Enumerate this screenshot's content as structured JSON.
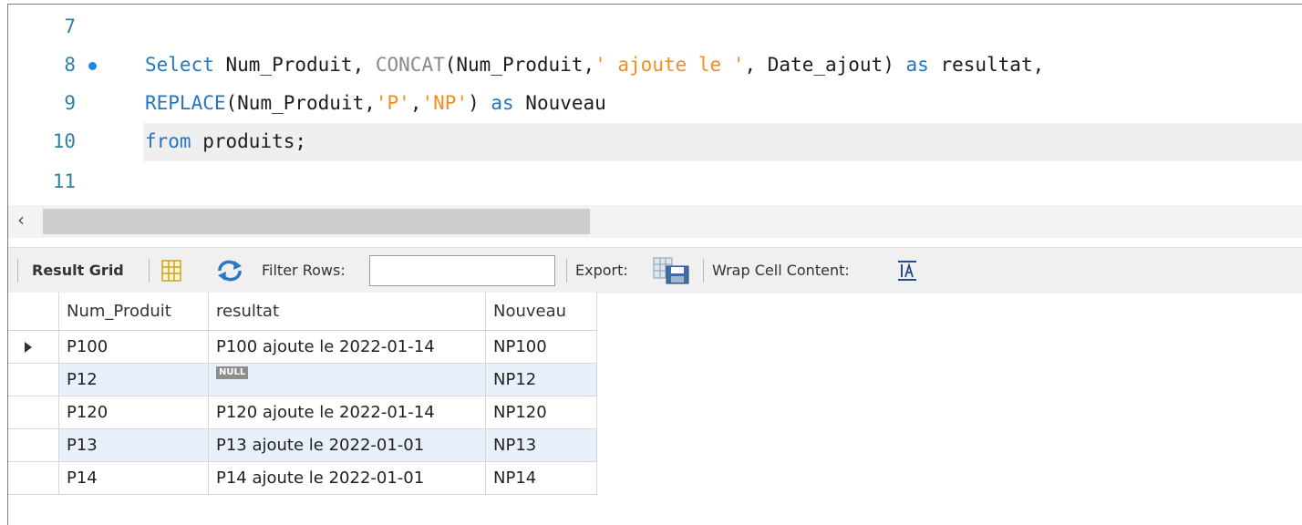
{
  "editor": {
    "lines": [
      {
        "no": "7"
      },
      {
        "no": "8",
        "select_kw": "Select",
        "t1": " Num_Produit, ",
        "concat_fn": "CONCAT",
        "t2": "(Num_Produit,",
        "s1": "' ajoute le '",
        "t3": ", Date_ajout) ",
        "as_kw": "as",
        "t4": " resultat,"
      },
      {
        "no": "9",
        "replace_fn": "REPLACE",
        "t1": "(Num_Produit,",
        "s1": "'P'",
        "t2": ",",
        "s2": "'NP'",
        "t3": ") ",
        "as_kw": "as",
        "t4": " Nouveau"
      },
      {
        "no": "10",
        "from_kw": "from",
        "t1": " produits;"
      },
      {
        "no": "11"
      }
    ]
  },
  "toolbar": {
    "result_grid_label": "Result Grid",
    "filter_rows_label": "Filter Rows:",
    "filter_value": "",
    "export_label": "Export:",
    "wrap_label": "Wrap Cell Content:"
  },
  "grid": {
    "columns": [
      "Num_Produit",
      "resultat",
      "Nouveau"
    ],
    "null_label": "NULL",
    "rows": [
      {
        "num": "P100",
        "resultat": "P100 ajoute le 2022-01-14",
        "nouveau": "NP100"
      },
      {
        "num": "P12",
        "resultat": "",
        "nouveau": "NP12"
      },
      {
        "num": "P120",
        "resultat": "P120 ajoute le 2022-01-14",
        "nouveau": "NP120"
      },
      {
        "num": "P13",
        "resultat": "P13 ajoute le 2022-01-01",
        "nouveau": "NP13"
      },
      {
        "num": "P14",
        "resultat": "P14 ajoute le 2022-01-01",
        "nouveau": "NP14"
      }
    ]
  },
  "icons": {
    "breakpoint": "breakpoint-dot-icon",
    "grid": "grid-view-icon",
    "refresh": "refresh-icon",
    "export": "export-icon",
    "wrap": "wrap-cell-icon",
    "row_marker": "current-row-icon"
  },
  "colors": {
    "keyword": "#2277c4",
    "string": "#f28e1e",
    "line_number": "#2f7fa8",
    "alt_row": "#e8f0fb"
  }
}
